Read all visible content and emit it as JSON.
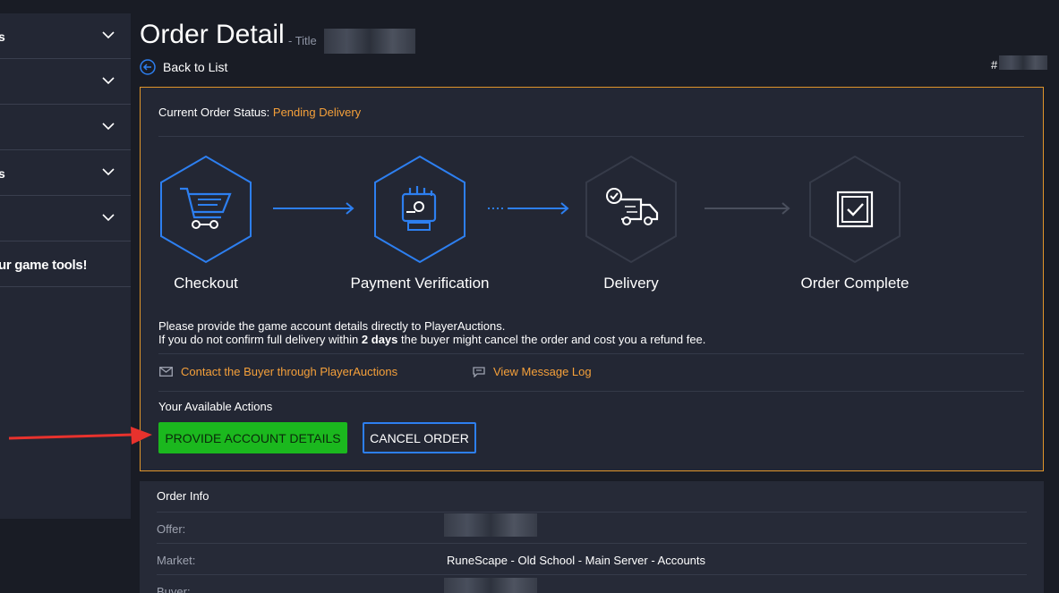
{
  "sidebar": {
    "items": [
      {
        "label": "s"
      },
      {
        "label": ""
      },
      {
        "label": ""
      },
      {
        "label": "s"
      },
      {
        "label": ""
      }
    ],
    "promo": "ur game tools!"
  },
  "header": {
    "title": "Order Detail",
    "title_suffix": "- Title",
    "back_label": "Back to List",
    "order_prefix": "#"
  },
  "status": {
    "label": "Current Order Status:",
    "value": "Pending Delivery",
    "steps": [
      {
        "label": "Checkout",
        "icon": "cart-icon",
        "state": "done"
      },
      {
        "label": "Payment Verification",
        "icon": "payment-icon",
        "state": "done"
      },
      {
        "label": "Delivery",
        "icon": "delivery-truck-icon",
        "state": "current"
      },
      {
        "label": "Order Complete",
        "icon": "checkbox-icon",
        "state": "pending"
      }
    ],
    "info_line1": "Please provide the game account details directly to PlayerAuctions.",
    "info_line2_pre": "If you do not confirm full delivery within",
    "info_line2_bold": "2 days",
    "info_line2_post": "the buyer might cancel the order and cost you a refund fee.",
    "contact_label": "Contact the Buyer through PlayerAuctions",
    "message_log_label": "View Message Log",
    "actions_title": "Your Available Actions",
    "provide_button": "PROVIDE ACCOUNT DETAILS",
    "cancel_button": "CANCEL ORDER"
  },
  "order_info": {
    "title": "Order Info",
    "rows": [
      {
        "label": "Offer:",
        "value": ""
      },
      {
        "label": "Market:",
        "value": "RuneScape - Old School - Main Server - Accounts"
      },
      {
        "label": "Buyer:",
        "value": ""
      }
    ]
  },
  "colors": {
    "accent_orange": "#f5a03a",
    "step_blue": "#2d7ff0",
    "button_green": "#1bb81e",
    "background": "#191c25"
  }
}
